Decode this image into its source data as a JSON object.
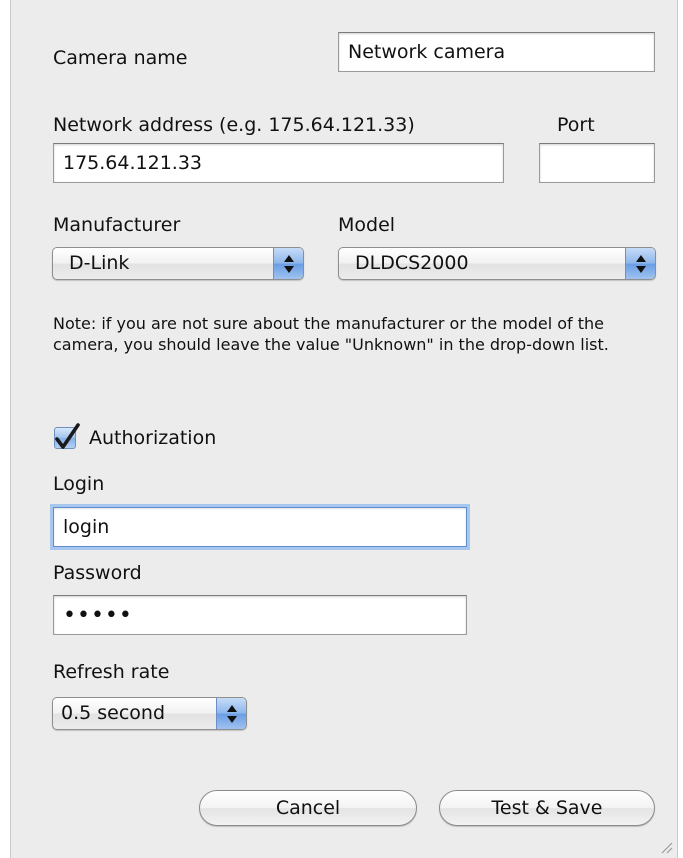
{
  "form": {
    "camera_name": {
      "label": "Camera name",
      "value": "Network camera"
    },
    "network_address": {
      "label": "Network address (e.g. 175.64.121.33)",
      "value": "175.64.121.33"
    },
    "port": {
      "label": "Port",
      "value": ""
    },
    "manufacturer": {
      "label": "Manufacturer",
      "selected": "D-Link"
    },
    "model": {
      "label": "Model",
      "selected": "DLDCS2000"
    },
    "note": "Note: if you are not sure about the manufacturer or the model of the camera, you should leave the value \"Unknown\" in the drop-down list.",
    "authorization": {
      "label": "Authorization",
      "checked": true
    },
    "login": {
      "label": "Login",
      "value": "login"
    },
    "password": {
      "label": "Password",
      "value": "•••••"
    },
    "refresh_rate": {
      "label": "Refresh rate",
      "selected": "0.5 second"
    }
  },
  "buttons": {
    "cancel_label": "Cancel",
    "test_save_label": "Test & Save"
  },
  "colors": {
    "window_background": "#ececec",
    "focus_ring": "#a8c7ef",
    "popup_arrow_blue": "#8db6ea"
  },
  "icons": {
    "popup_arrows": "up-down-arrows-icon",
    "check": "checkmark-icon",
    "resize": "resize-grip-icon"
  }
}
